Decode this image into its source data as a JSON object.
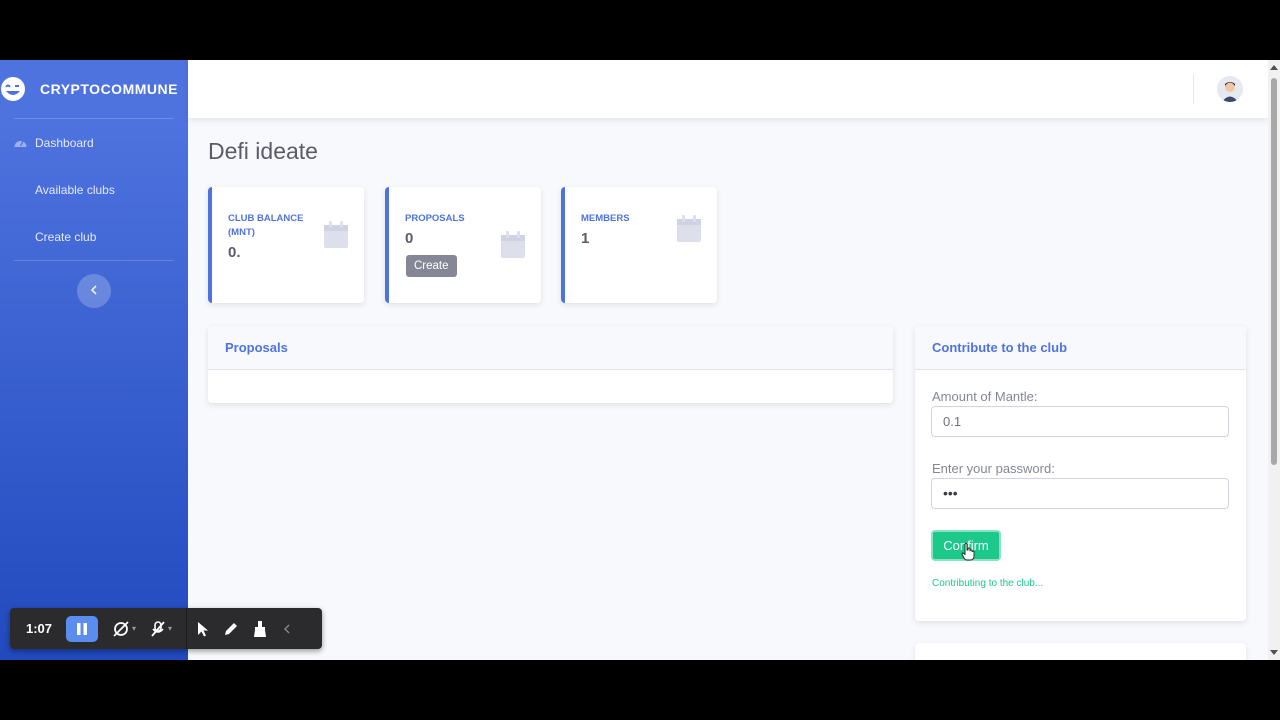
{
  "brand": {
    "name": "CRYPTOCOMMUNE"
  },
  "sidebar": {
    "items": [
      {
        "label": "Dashboard",
        "icon": "tachometer-icon"
      },
      {
        "label": "Available clubs"
      },
      {
        "label": "Create club"
      }
    ],
    "toggle_icon": "chevron-left-icon"
  },
  "page": {
    "title": "Defi ideate"
  },
  "stats": [
    {
      "label": "CLUB BALANCE (MNT)",
      "value": "0.",
      "icon": "calendar-icon"
    },
    {
      "label": "PROPOSALS",
      "value": "0",
      "button": "Create",
      "icon": "calendar-icon"
    },
    {
      "label": "MEMBERS",
      "value": "1",
      "icon": "calendar-icon"
    }
  ],
  "proposals": {
    "header": "Proposals"
  },
  "contribute": {
    "header": "Contribute to the club",
    "amount_label": "Amount of Mantle:",
    "amount_value": "0.1",
    "password_label": "Enter your password:",
    "password_value": "•••",
    "confirm_label": "Confirm",
    "status": "Contributing to the club..."
  },
  "recorder": {
    "time": "1:07"
  },
  "colors": {
    "primary": "#4e73df",
    "success": "#1cc88a",
    "secondary": "#858796"
  }
}
